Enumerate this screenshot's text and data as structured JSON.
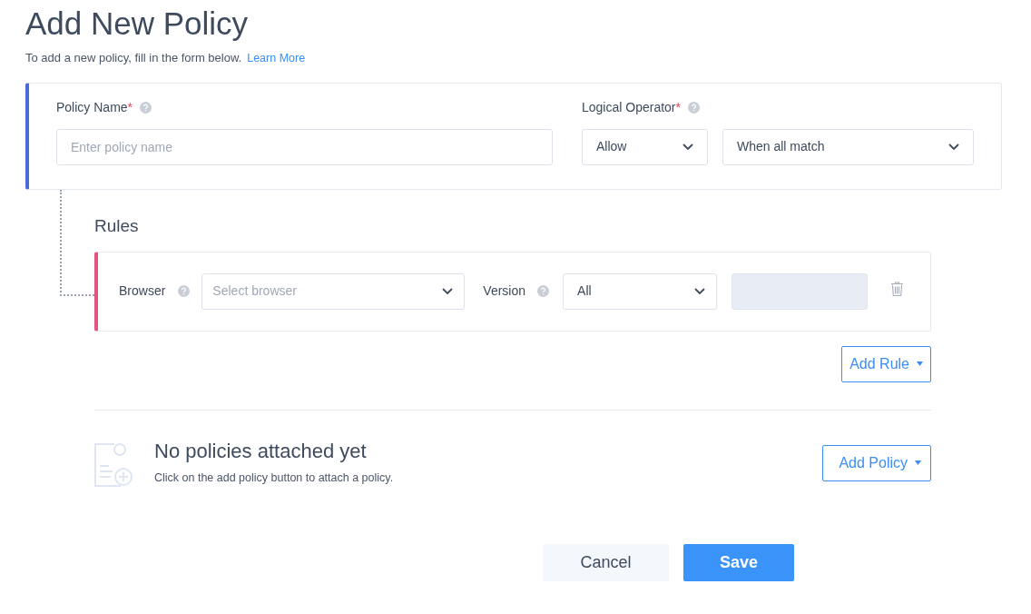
{
  "page": {
    "title": "Add New Policy",
    "subtitle": "To add a new policy, fill in the form below.",
    "learn_more": "Learn More"
  },
  "policy_card": {
    "fields": [
      {
        "kind": "text",
        "label": "Policy Name",
        "required_mark": "*",
        "placeholder": "Enter policy name"
      },
      {
        "kind": "selects",
        "label": "Logical Operator",
        "required_mark": "*",
        "selects": [
          {
            "value": "Allow"
          },
          {
            "value": "When all match"
          }
        ]
      }
    ]
  },
  "rules": {
    "title": "Rules",
    "rows": [
      {
        "browser_label": "Browser",
        "browser_placeholder": "Select browser",
        "version_label": "Version",
        "version_value": "All",
        "extra_field_disabled": true
      }
    ],
    "add_button": "Add Rule"
  },
  "empty_state": {
    "title": "No policies attached yet",
    "text": "Click on the add policy button to attach a policy.",
    "button": "Add Policy"
  },
  "footer": {
    "cancel": "Cancel",
    "save": "Save"
  }
}
